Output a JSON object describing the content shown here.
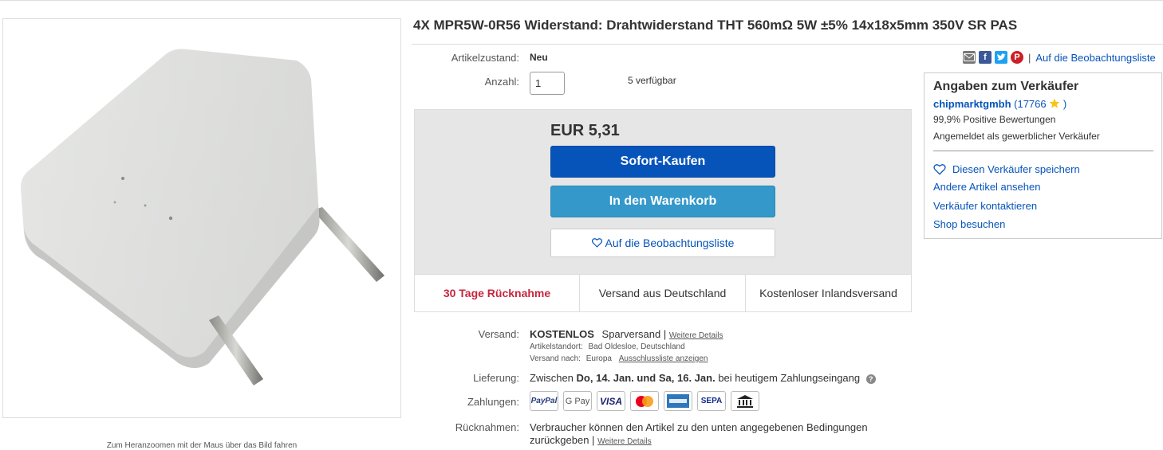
{
  "product": {
    "title": "4X MPR5W-0R56 Widerstand: Drahtwiderstand THT 560mΩ 5W ±5% 14x18x5mm 350V SR PAS",
    "zoom_hint": "Zum Heranzoomen mit der Maus über das Bild fahren"
  },
  "details": {
    "condition_label": "Artikelzustand:",
    "condition_value": "Neu",
    "quantity_label": "Anzahl:",
    "quantity_value": "1",
    "available": "5 verfügbar"
  },
  "buybox": {
    "price": "EUR 5,31",
    "buy_now": "Sofort-Kaufen",
    "add_to_cart": "In den Warenkorb",
    "watch": "Auf die Beobachtungsliste",
    "features": [
      "30 Tage Rücknahme",
      "Versand aus Deutschland",
      "Kostenloser Inlandsversand"
    ]
  },
  "shipping": {
    "label": "Versand:",
    "cost": "KOSTENLOS",
    "method": "Sparversand |",
    "details_link": "Weitere Details",
    "location_label": "Artikelstandort:",
    "location": "Bad Oldesloe, Deutschland",
    "ships_to_label": "Versand nach:",
    "ships_to": "Europa",
    "exclusions_link": "Ausschlussliste anzeigen"
  },
  "delivery": {
    "label": "Lieferung:",
    "prefix": "Zwischen",
    "date_from": "Do, 14. Jan.",
    "and": "und",
    "date_to": "Sa, 16. Jan.",
    "suffix": "bei heutigem Zahlungseingang",
    "help_icon": "?"
  },
  "payments": {
    "label": "Zahlungen:",
    "methods": [
      "PayPal",
      "G Pay",
      "VISA",
      "",
      "",
      "SEPA",
      ""
    ]
  },
  "returns": {
    "label": "Rücknahmen:",
    "text_line1": "Verbraucher können den Artikel zu den unten angegebenen Bedingungen",
    "text_line2": "zurückgeben |",
    "details_link": "Weitere Details"
  },
  "share": {
    "separator": "|",
    "watch_link": "Auf die Beobachtungsliste"
  },
  "seller": {
    "heading": "Angaben zum Verkäufer",
    "name": "chipmarktgmbh",
    "rating_open": "(17766",
    "rating_close": ")",
    "feedback": "99,9% Positive Bewertungen",
    "registered": "Angemeldet als gewerblicher Verkäufer",
    "save_seller": "Diesen Verkäufer speichern",
    "other_items": "Andere Artikel ansehen",
    "contact": "Verkäufer kontaktieren",
    "shop": "Shop besuchen"
  },
  "colors": {
    "link_blue": "#0654ba",
    "buy_button": "#0654ba",
    "cart_button": "#3498ca",
    "return_red": "#c7263e"
  }
}
